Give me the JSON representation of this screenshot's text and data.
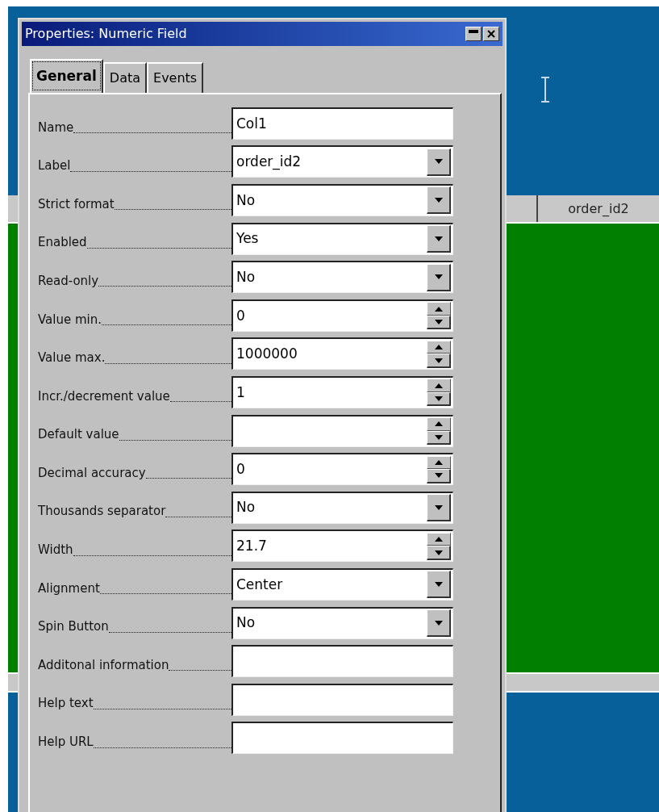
{
  "grid": {
    "header": "order_id2"
  },
  "dialog": {
    "title": "Properties: Numeric Field",
    "tabs": [
      {
        "label": "General",
        "selected": true
      },
      {
        "label": "Data",
        "selected": false
      },
      {
        "label": "Events",
        "selected": false
      }
    ],
    "rows": [
      {
        "label": "Name",
        "kind": "text",
        "value": "Col1"
      },
      {
        "label": "Label",
        "kind": "dropdown",
        "value": "order_id2"
      },
      {
        "label": "Strict format",
        "kind": "dropdown",
        "value": "No"
      },
      {
        "label": "Enabled",
        "kind": "dropdown",
        "value": "Yes"
      },
      {
        "label": "Read-only",
        "kind": "dropdown",
        "value": "No"
      },
      {
        "label": "Value min.",
        "kind": "spin",
        "value": "0"
      },
      {
        "label": "Value max.",
        "kind": "spin",
        "value": "1000000"
      },
      {
        "label": "Incr./decrement value",
        "kind": "spin",
        "value": "1"
      },
      {
        "label": "Default value",
        "kind": "spin"
      },
      {
        "label": "Decimal accuracy",
        "kind": "spin",
        "value": "0"
      },
      {
        "label": "Thousands separator",
        "kind": "dropdown",
        "value": "No"
      },
      {
        "label": "Width",
        "kind": "spin",
        "value": "21.7"
      },
      {
        "label": "Alignment",
        "kind": "dropdown",
        "value": "Center"
      },
      {
        "label": "Spin Button",
        "kind": "dropdown",
        "value": "No"
      },
      {
        "label": "Additonal information",
        "kind": "text"
      },
      {
        "label": "Help text",
        "kind": "text"
      },
      {
        "label": "Help URL",
        "kind": "text"
      }
    ]
  }
}
